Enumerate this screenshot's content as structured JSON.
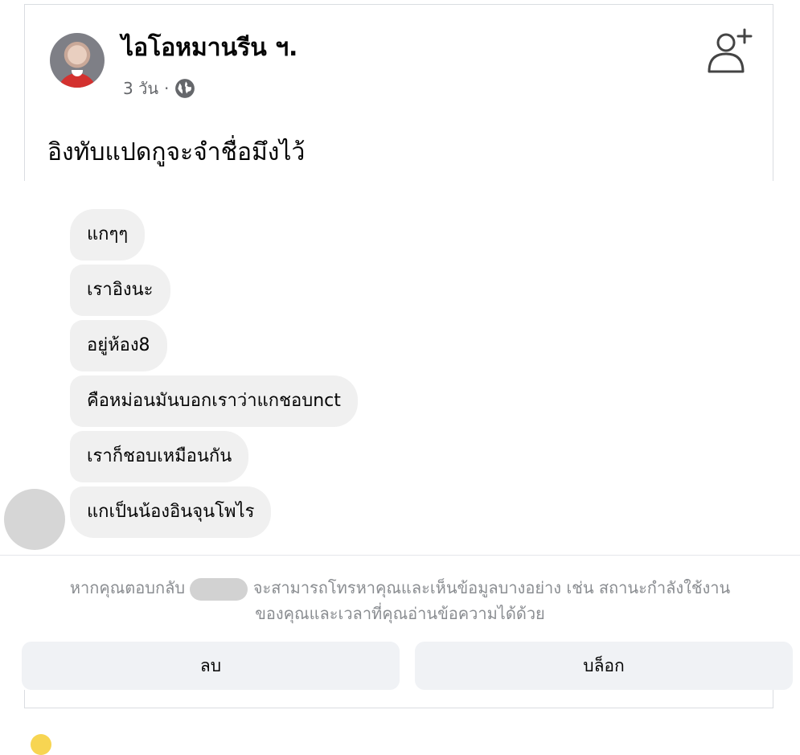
{
  "post": {
    "author": "ไอโอหมานรีน ฯ.",
    "time": "3 วัน",
    "separator": "·",
    "audience_icon": "globe-icon",
    "text": "อิงทับแปดกูจะจำชื่อมึงไว้",
    "action_icon": "add-friend-icon"
  },
  "chat": {
    "messages": [
      "แกๆๆ",
      "เราอิงนะ",
      "อยู่ห้อง8",
      "คือหม่อนมันบอกเราว่าแกชอบnct",
      "เราก็ชอบเหมือนกัน",
      "แกเป็นน้องอินจุนโพไร"
    ]
  },
  "request": {
    "notice_before": "หากคุณตอบกลับ ",
    "notice_after": " จะสามารถโทรหาคุณและเห็นข้อมูลบางอย่าง เช่น สถานะกำลังใช้งาน",
    "notice_line2": "ของคุณและเวลาที่คุณอ่านข้อความได้ด้วย",
    "delete_label": "ลบ",
    "block_label": "บล็อก"
  }
}
